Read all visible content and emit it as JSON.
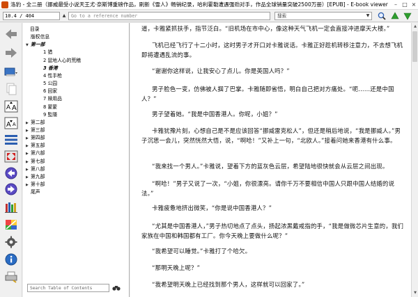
{
  "window": {
    "title": "洛豹 - 全二册（挪威最受小说天王尤·奈斯博重磅作品，刷新《雪人》畅销纪录，哈利霍勒遭遇强劲对手，作品全球销量突破2500万册）[EPUB] - E-book viewer",
    "controls": {
      "minimize": "–",
      "maximize": "□",
      "close": "×"
    }
  },
  "navbar": {
    "location": "10.4 / 404",
    "reference_placeholder": "Go to a reference number",
    "search_placeholder": "搜索"
  },
  "toc": {
    "search_placeholder": "Search Table of Contents",
    "items": [
      {
        "label": "目录",
        "indent": 0,
        "arrow": ""
      },
      {
        "label": "版权信息",
        "indent": 1,
        "arrow": ""
      },
      {
        "label": "第一部",
        "indent": 1,
        "arrow": "▼",
        "current": true
      },
      {
        "label": "1 猎",
        "indent": 2,
        "arrow": ""
      },
      {
        "label": "2 鼠地人心的荒稽",
        "indent": 2,
        "arrow": ""
      },
      {
        "label": "3 香港",
        "indent": 2,
        "arrow": "",
        "current": true
      },
      {
        "label": "4 性手枪",
        "indent": 2,
        "arrow": ""
      },
      {
        "label": "5 公园",
        "indent": 2,
        "arrow": ""
      },
      {
        "label": "6 回家",
        "indent": 2,
        "arrow": ""
      },
      {
        "label": "7 赎用品",
        "indent": 2,
        "arrow": ""
      },
      {
        "label": "8 蒙蒙",
        "indent": 2,
        "arrow": ""
      },
      {
        "label": "9 監隱",
        "indent": 2,
        "arrow": ""
      },
      {
        "label": "第二部",
        "indent": 1,
        "arrow": "▶"
      },
      {
        "label": "第三部",
        "indent": 1,
        "arrow": "▶"
      },
      {
        "label": "第四部",
        "indent": 1,
        "arrow": "▶"
      },
      {
        "label": "第五部",
        "indent": 1,
        "arrow": "▶"
      },
      {
        "label": "第六部",
        "indent": 1,
        "arrow": "▶"
      },
      {
        "label": "第七部",
        "indent": 1,
        "arrow": "▶"
      },
      {
        "label": "第八部",
        "indent": 1,
        "arrow": "▶"
      },
      {
        "label": "第九部",
        "indent": 1,
        "arrow": "▶"
      },
      {
        "label": "第十部",
        "indent": 1,
        "arrow": "▶"
      },
      {
        "label": "尾声",
        "indent": 1,
        "arrow": ""
      }
    ]
  },
  "reader": {
    "paragraphs": [
      "道，卡雅紧抓扶手，指节泛白。“旧机场在市中心，像这种天气飞机一定会直接冲进摩天大楼。”",
      "飞机已经飞行了十二小时，这时男子才开口对卡雅说话。卡雅正好趁机转移注意力，不去想飞机即将遭遇乱流的事。",
      "“谢谢你这样说，让我安心了点儿。你是英国人吗？”",
      "男子脸色一变，仿佛被人掴了巴掌。卡雅随即省悟，明白自己把对方痛处。“呃……还是中国人？”",
      "男子望着她。“我是中国香港人。你呢，小姐？”",
      "卡雅犹豫片刻，心想自己是不是应该回答“挪威雷克松人”，但还是稍后地说，“我是挪威人。”男子沉思一会儿，突然恍然大悟，说，“啊哈！”又补上一句，“北欧人。”接着问她来香港有什么事。",
      "“我来找一个男人。”卡雅说，望着下方的蓝灰色云层，希望陆地很快就会从云层之间出现。",
      "“啊哈！”男子又说了一次，“小姐，你很漂亮。请你千万不要相信中国人只跟中国人结婚的说法。”",
      "卡雅疲惫地挤出微笑，“你是说中国香港人？”",
      "“尤其是中国香港人，”男子热切地点了点头，扬起浓黑戴戒指的手，“我是做微芯片生意的，我们家族在中国和韩国都有工厂。你今天晚上要做什么呢？”",
      "“我希望可以睡觉。”卡雅打了个哈欠。",
      "“那明天晚上呢？”",
      "“我希望明天晚上已经找到那个男人，这样就可以回家了。”"
    ]
  },
  "colors": {
    "accent_blue": "#2a5db0",
    "nav_green": "#2e9e2e",
    "toolbar_bg": "#f0f0f0",
    "page_bg": "#ffffff"
  },
  "icons": {
    "toolbar": [
      "back-icon",
      "forward-icon",
      "library-icon",
      "copy-icon",
      "font-larger-icon",
      "font-smaller-icon",
      "toc-icon",
      "fullscreen-icon",
      "previous-page-icon",
      "next-page-icon",
      "bookmark-icon",
      "reference-mode-icon",
      "theme-icon",
      "preferences-icon",
      "info-icon",
      "print-icon"
    ]
  }
}
